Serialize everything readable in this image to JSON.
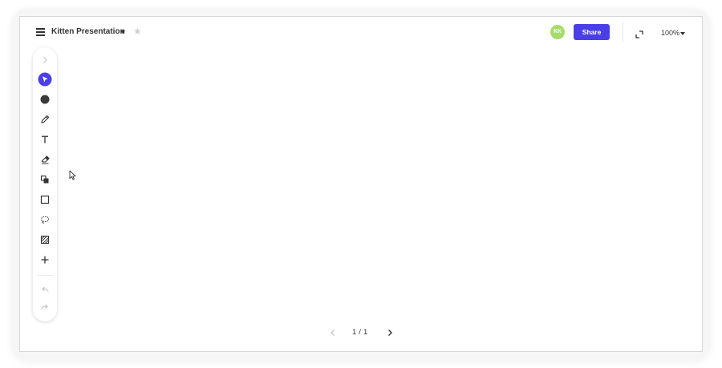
{
  "header": {
    "title": "Kitten Presentation",
    "avatar_initials": "KK",
    "share_label": "Share",
    "zoom_level": "100%"
  },
  "pagination": {
    "current": "1",
    "separator": "/",
    "total": "1"
  },
  "toolbar": {
    "tools": [
      "expand-chevron",
      "select",
      "color",
      "pen",
      "text",
      "eraser",
      "shapes-stack",
      "rectangle",
      "lasso",
      "pattern-fill",
      "add",
      "undo",
      "redo"
    ],
    "active_tool": "select"
  },
  "colors": {
    "accent": "#4a3fe6",
    "avatar_bg": "#a6dc6b",
    "tool_color_swatch": "#3a3a3a",
    "disabled": "#c4c4c8"
  }
}
